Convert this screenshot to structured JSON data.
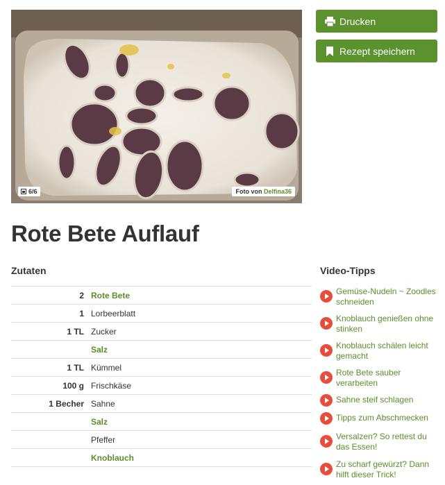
{
  "photo": {
    "counter": "6/6",
    "credit_prefix": "Foto von",
    "credit_author": "Delfina36"
  },
  "actions": {
    "print_label": "Drucken",
    "save_label": "Rezept speichern",
    "accent": "#5b922e"
  },
  "recipe": {
    "title": "Rote Bete Auflauf"
  },
  "ingredients": {
    "heading": "Zutaten",
    "items": [
      {
        "amount": "2",
        "name": "Rote Bete",
        "link": true
      },
      {
        "amount": "1",
        "name": "Lorbeerblatt",
        "link": false
      },
      {
        "amount": "1 TL",
        "name": "Zucker",
        "link": false
      },
      {
        "amount": "",
        "name": "Salz",
        "link": true
      },
      {
        "amount": "1 TL",
        "name": "Kümmel",
        "link": false
      },
      {
        "amount": "100 g",
        "name": "Frischkäse",
        "link": false
      },
      {
        "amount": "1 Becher",
        "name": "Sahne",
        "link": false
      },
      {
        "amount": "",
        "name": "Salz",
        "link": true
      },
      {
        "amount": "",
        "name": "Pfeffer",
        "link": false
      },
      {
        "amount": "",
        "name": "Knoblauch",
        "link": true
      }
    ]
  },
  "video_tips": {
    "heading": "Video-Tipps",
    "items": [
      "Gemüse-Nudeln ~ Zoodles schneiden",
      "Knoblauch genießen ohne stinken",
      "Knoblauch schälen leicht gemacht",
      "Rote Bete sauber verarbeiten",
      "Sahne steif schlagen",
      "Tipps zum Abschmecken",
      "Versalzen? So rettest du das Essen!",
      "Zu scharf gewürzt? Dann hilft dieser Trick!"
    ]
  }
}
